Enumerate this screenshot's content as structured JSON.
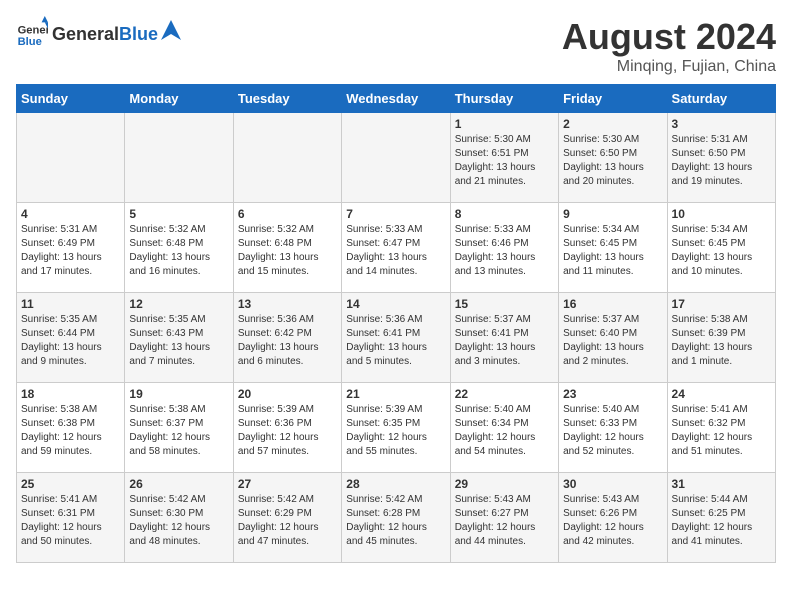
{
  "header": {
    "logo_general": "General",
    "logo_blue": "Blue",
    "month_title": "August 2024",
    "location": "Minqing, Fujian, China"
  },
  "weekdays": [
    "Sunday",
    "Monday",
    "Tuesday",
    "Wednesday",
    "Thursday",
    "Friday",
    "Saturday"
  ],
  "weeks": [
    [
      {
        "day": "",
        "info": ""
      },
      {
        "day": "",
        "info": ""
      },
      {
        "day": "",
        "info": ""
      },
      {
        "day": "",
        "info": ""
      },
      {
        "day": "1",
        "info": "Sunrise: 5:30 AM\nSunset: 6:51 PM\nDaylight: 13 hours\nand 21 minutes."
      },
      {
        "day": "2",
        "info": "Sunrise: 5:30 AM\nSunset: 6:50 PM\nDaylight: 13 hours\nand 20 minutes."
      },
      {
        "day": "3",
        "info": "Sunrise: 5:31 AM\nSunset: 6:50 PM\nDaylight: 13 hours\nand 19 minutes."
      }
    ],
    [
      {
        "day": "4",
        "info": "Sunrise: 5:31 AM\nSunset: 6:49 PM\nDaylight: 13 hours\nand 17 minutes."
      },
      {
        "day": "5",
        "info": "Sunrise: 5:32 AM\nSunset: 6:48 PM\nDaylight: 13 hours\nand 16 minutes."
      },
      {
        "day": "6",
        "info": "Sunrise: 5:32 AM\nSunset: 6:48 PM\nDaylight: 13 hours\nand 15 minutes."
      },
      {
        "day": "7",
        "info": "Sunrise: 5:33 AM\nSunset: 6:47 PM\nDaylight: 13 hours\nand 14 minutes."
      },
      {
        "day": "8",
        "info": "Sunrise: 5:33 AM\nSunset: 6:46 PM\nDaylight: 13 hours\nand 13 minutes."
      },
      {
        "day": "9",
        "info": "Sunrise: 5:34 AM\nSunset: 6:45 PM\nDaylight: 13 hours\nand 11 minutes."
      },
      {
        "day": "10",
        "info": "Sunrise: 5:34 AM\nSunset: 6:45 PM\nDaylight: 13 hours\nand 10 minutes."
      }
    ],
    [
      {
        "day": "11",
        "info": "Sunrise: 5:35 AM\nSunset: 6:44 PM\nDaylight: 13 hours\nand 9 minutes."
      },
      {
        "day": "12",
        "info": "Sunrise: 5:35 AM\nSunset: 6:43 PM\nDaylight: 13 hours\nand 7 minutes."
      },
      {
        "day": "13",
        "info": "Sunrise: 5:36 AM\nSunset: 6:42 PM\nDaylight: 13 hours\nand 6 minutes."
      },
      {
        "day": "14",
        "info": "Sunrise: 5:36 AM\nSunset: 6:41 PM\nDaylight: 13 hours\nand 5 minutes."
      },
      {
        "day": "15",
        "info": "Sunrise: 5:37 AM\nSunset: 6:41 PM\nDaylight: 13 hours\nand 3 minutes."
      },
      {
        "day": "16",
        "info": "Sunrise: 5:37 AM\nSunset: 6:40 PM\nDaylight: 13 hours\nand 2 minutes."
      },
      {
        "day": "17",
        "info": "Sunrise: 5:38 AM\nSunset: 6:39 PM\nDaylight: 13 hours\nand 1 minute."
      }
    ],
    [
      {
        "day": "18",
        "info": "Sunrise: 5:38 AM\nSunset: 6:38 PM\nDaylight: 12 hours\nand 59 minutes."
      },
      {
        "day": "19",
        "info": "Sunrise: 5:38 AM\nSunset: 6:37 PM\nDaylight: 12 hours\nand 58 minutes."
      },
      {
        "day": "20",
        "info": "Sunrise: 5:39 AM\nSunset: 6:36 PM\nDaylight: 12 hours\nand 57 minutes."
      },
      {
        "day": "21",
        "info": "Sunrise: 5:39 AM\nSunset: 6:35 PM\nDaylight: 12 hours\nand 55 minutes."
      },
      {
        "day": "22",
        "info": "Sunrise: 5:40 AM\nSunset: 6:34 PM\nDaylight: 12 hours\nand 54 minutes."
      },
      {
        "day": "23",
        "info": "Sunrise: 5:40 AM\nSunset: 6:33 PM\nDaylight: 12 hours\nand 52 minutes."
      },
      {
        "day": "24",
        "info": "Sunrise: 5:41 AM\nSunset: 6:32 PM\nDaylight: 12 hours\nand 51 minutes."
      }
    ],
    [
      {
        "day": "25",
        "info": "Sunrise: 5:41 AM\nSunset: 6:31 PM\nDaylight: 12 hours\nand 50 minutes."
      },
      {
        "day": "26",
        "info": "Sunrise: 5:42 AM\nSunset: 6:30 PM\nDaylight: 12 hours\nand 48 minutes."
      },
      {
        "day": "27",
        "info": "Sunrise: 5:42 AM\nSunset: 6:29 PM\nDaylight: 12 hours\nand 47 minutes."
      },
      {
        "day": "28",
        "info": "Sunrise: 5:42 AM\nSunset: 6:28 PM\nDaylight: 12 hours\nand 45 minutes."
      },
      {
        "day": "29",
        "info": "Sunrise: 5:43 AM\nSunset: 6:27 PM\nDaylight: 12 hours\nand 44 minutes."
      },
      {
        "day": "30",
        "info": "Sunrise: 5:43 AM\nSunset: 6:26 PM\nDaylight: 12 hours\nand 42 minutes."
      },
      {
        "day": "31",
        "info": "Sunrise: 5:44 AM\nSunset: 6:25 PM\nDaylight: 12 hours\nand 41 minutes."
      }
    ]
  ]
}
